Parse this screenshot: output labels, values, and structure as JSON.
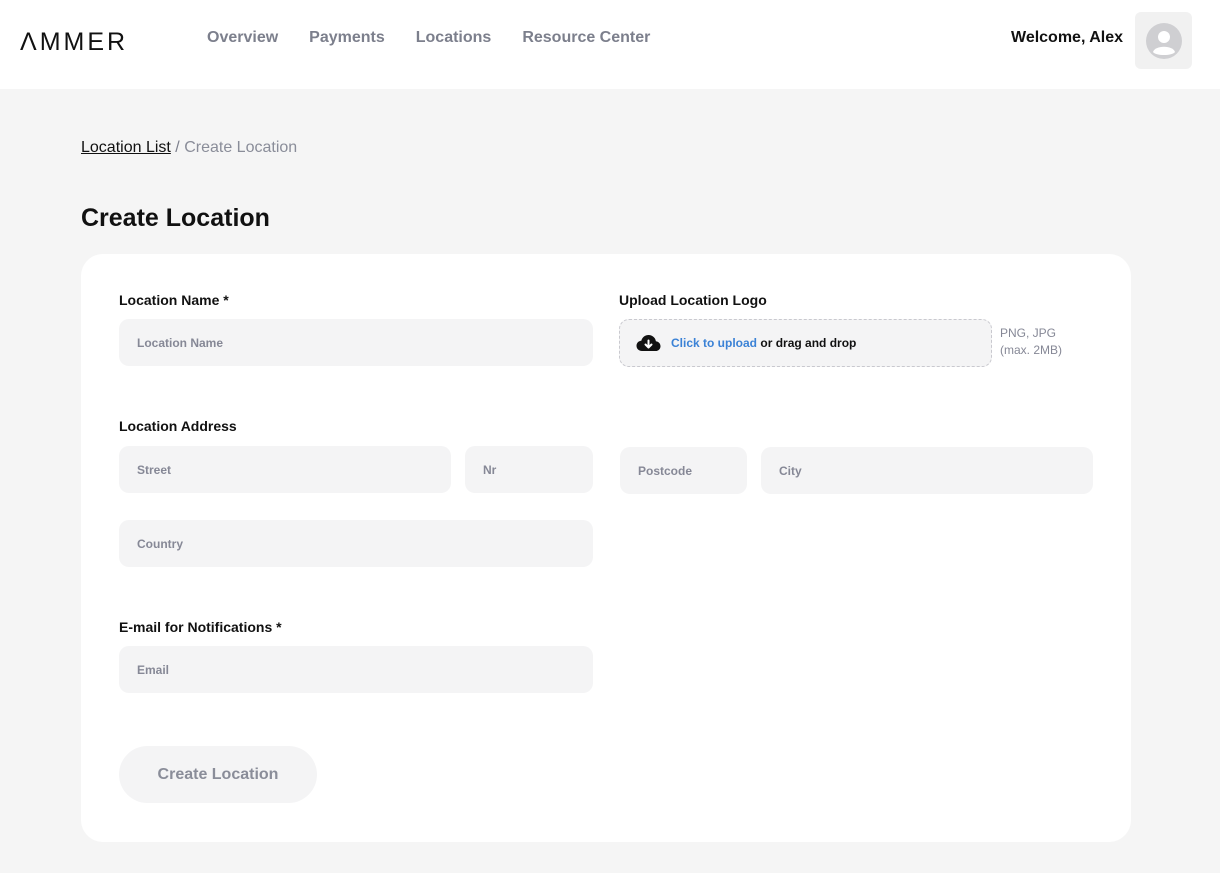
{
  "brand": {
    "logo_text": "ΛMMER"
  },
  "nav": {
    "items": [
      {
        "label": "Overview"
      },
      {
        "label": "Payments"
      },
      {
        "label": "Locations"
      },
      {
        "label": "Resource Center"
      }
    ]
  },
  "user": {
    "welcome": "Welcome, Alex",
    "avatar_icon": "user-avatar-icon"
  },
  "breadcrumb": {
    "parent": "Location List",
    "separator": "/",
    "current": "Create Location"
  },
  "page": {
    "title": "Create Location"
  },
  "form": {
    "location_name": {
      "label": "Location Name *",
      "placeholder": "Location Name",
      "value": ""
    },
    "logo": {
      "label": "Upload Location Logo",
      "icon": "cloud-upload-icon",
      "link_text": "Click to upload",
      "rest_text": "or drag and drop",
      "hint_line1": "PNG, JPG",
      "hint_line2": "(max. 2MB)"
    },
    "address": {
      "label": "Location Address",
      "street_placeholder": "Street",
      "nr_placeholder": "Nr",
      "postcode_placeholder": "Postcode",
      "city_placeholder": "City",
      "country_placeholder": "Country"
    },
    "email": {
      "label": "E-mail for Notifications *",
      "placeholder": "Email",
      "value": ""
    },
    "submit_label": "Create Location"
  }
}
